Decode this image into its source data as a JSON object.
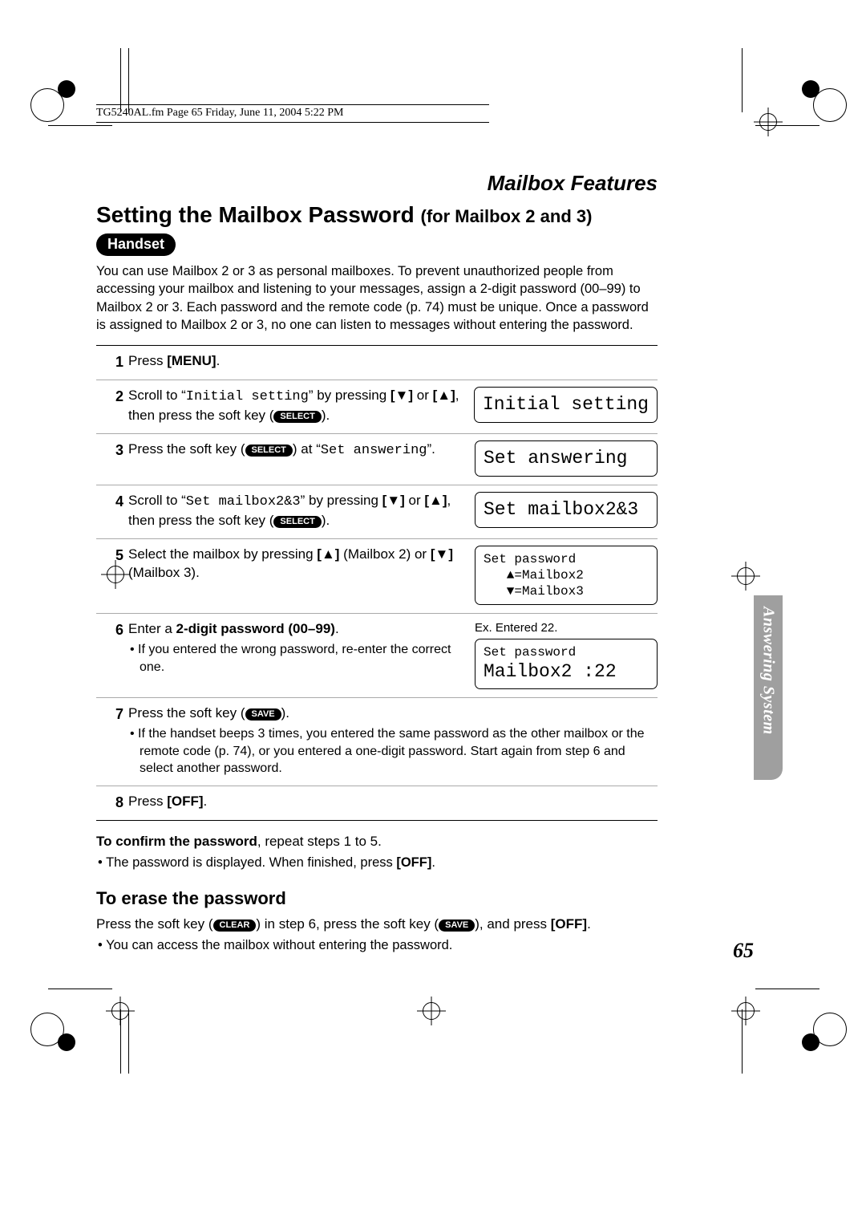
{
  "file_tag": "TG5240AL.fm  Page 65  Friday, June 11, 2004  5:22 PM",
  "section_header": "Mailbox Features",
  "title_main": "Setting the Mailbox Password ",
  "title_sub": "(for Mailbox 2 and 3)",
  "handset_pill": "Handset",
  "intro": "You can use Mailbox 2 or 3 as personal mailboxes. To prevent unauthorized people from accessing your mailbox and listening to your messages, assign a 2-digit password (00–99) to Mailbox 2 or 3. Each password and the remote code (p. 74) must be unique. Once a password is assigned to Mailbox 2 or 3, no one can listen to messages without entering the password.",
  "softkeys": {
    "select": "SELECT",
    "save": "SAVE",
    "clear": "CLEAR"
  },
  "steps": {
    "s1": {
      "num": "1",
      "pre": "Press ",
      "menu": "[MENU]",
      "post": "."
    },
    "s2": {
      "num": "2",
      "pre": "Scroll to “",
      "mono": "Initial setting",
      "mid": "” by pressing ",
      "arrow_dn": "[▼]",
      "or": " or ",
      "arrow_up": "[▲]",
      "then": ", then press the soft key (",
      "post": ").",
      "lcd": "Initial setting"
    },
    "s3": {
      "num": "3",
      "pre": "Press the soft key (",
      "mid": ") at “",
      "mono": "Set answering",
      "post": "”.",
      "lcd": "Set answering"
    },
    "s4": {
      "num": "4",
      "pre": "Scroll to “",
      "mono": "Set mailbox2&3",
      "mid": "” by pressing ",
      "arrow_dn": "[▼]",
      "or": " or ",
      "arrow_up": "[▲]",
      "then": ", then press the soft key (",
      "post": ").",
      "lcd": "Set mailbox2&3"
    },
    "s5": {
      "num": "5",
      "pre": "Select the mailbox by pressing ",
      "arrow_up": "[▲]",
      "mid": " (Mailbox 2) or ",
      "arrow_dn": "[▼]",
      "post": " (Mailbox 3).",
      "lcd_l1": "Set password",
      "lcd_l2": "   ▲=Mailbox2",
      "lcd_l3": "   ▼=Mailbox3"
    },
    "s6": {
      "num": "6",
      "pre": "Enter a ",
      "bold": "2-digit password (00–99)",
      "post": ".",
      "bullet": "If you entered the wrong password, re-enter the correct one.",
      "ex": "Ex. Entered 22.",
      "lcd_l1": "Set password",
      "lcd_l2": "Mailbox2 :22"
    },
    "s7": {
      "num": "7",
      "pre": "Press the soft key (",
      "post": ").",
      "bullet": "If the handset beeps 3 times, you entered the same password as the other mailbox or the remote code (p. 74), or you entered a one-digit password. Start again from step 6 and select another password."
    },
    "s8": {
      "num": "8",
      "pre": "Press ",
      "off": "[OFF]",
      "post": "."
    }
  },
  "confirm": {
    "lead_bold": "To confirm the password",
    "lead_rest": ", repeat steps 1 to 5.",
    "bullet_pre": "The password is displayed. When finished, press ",
    "off": "[OFF]",
    "bullet_post": "."
  },
  "erase": {
    "heading": "To erase the password",
    "line_pre": "Press the soft key (",
    "line_mid1": ") in step 6, press the soft key (",
    "line_mid2": "), and press ",
    "off": "[OFF]",
    "line_post": ".",
    "bullet": "You can access the mailbox without entering the password."
  },
  "sidetab": "Answering System",
  "pagenum": "65"
}
